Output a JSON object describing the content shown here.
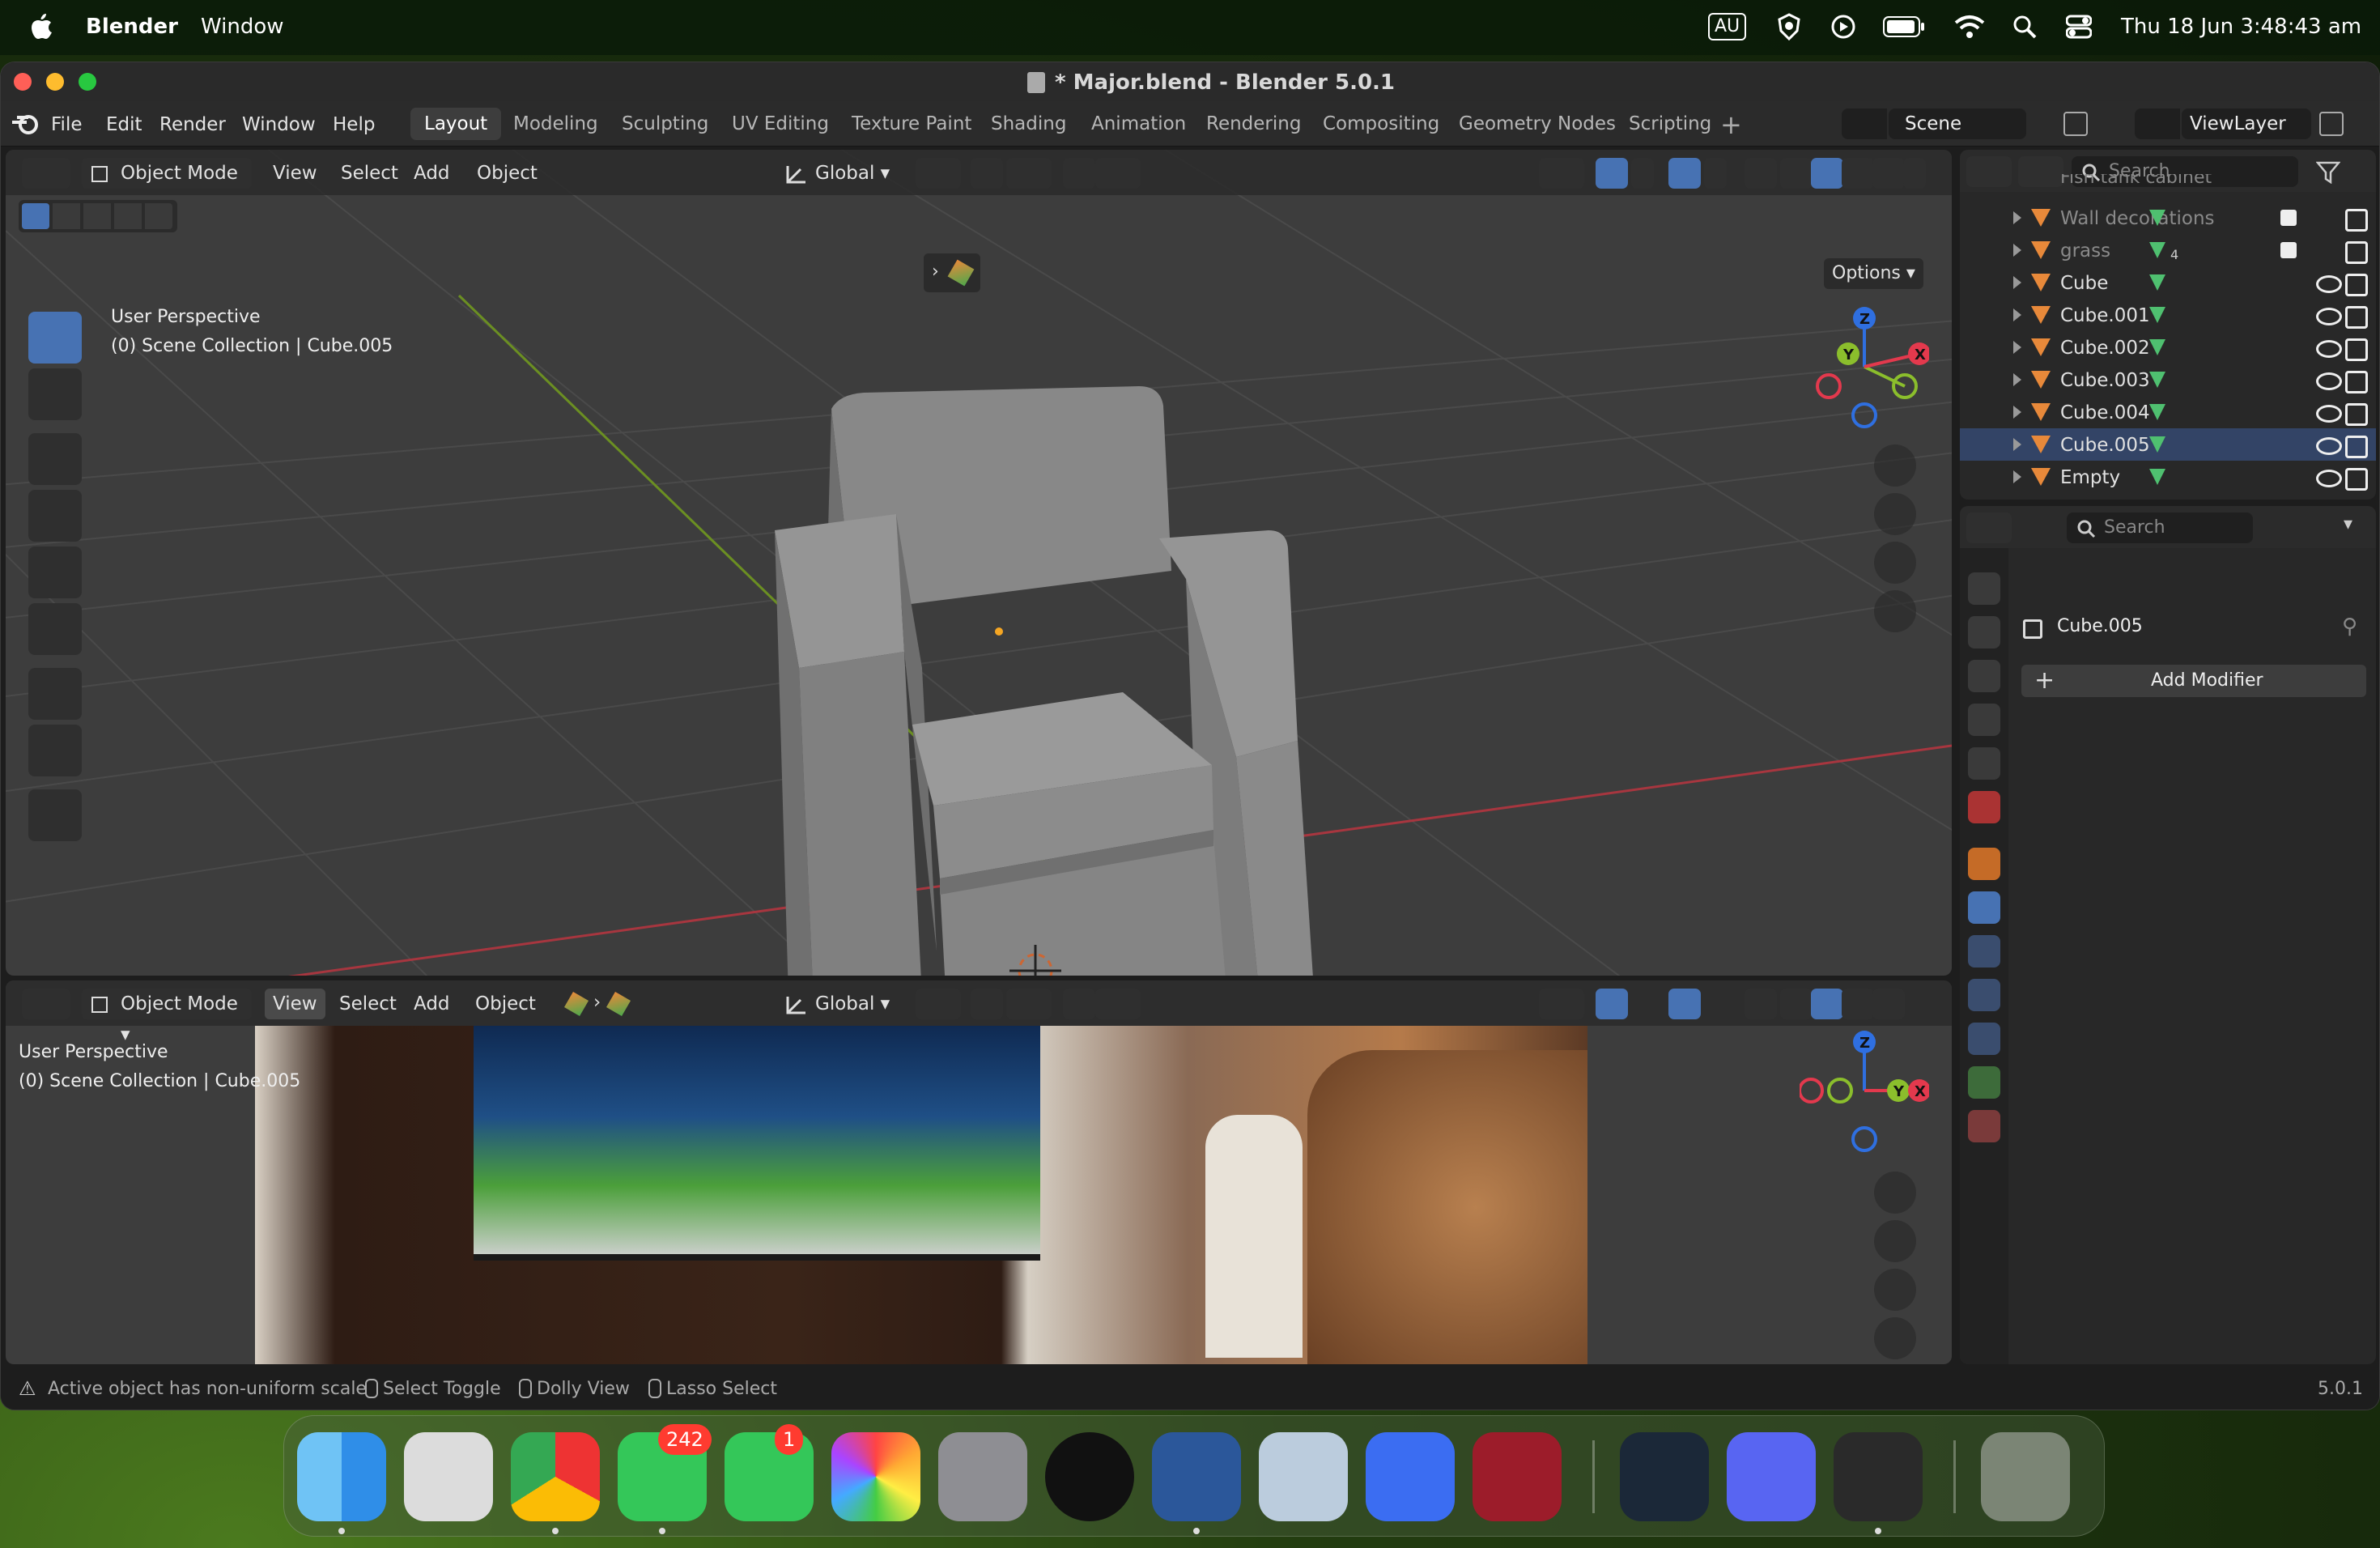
{
  "menubar": {
    "app": "Blender",
    "menu": "Window",
    "status": {
      "input_source": "AU",
      "datetime": "Thu 18 Jun  3:48:43 am"
    }
  },
  "window": {
    "title": "* Major.blend - Blender 5.0.1"
  },
  "topbar": {
    "menus": [
      "File",
      "Edit",
      "Render",
      "Window",
      "Help"
    ],
    "workspaces": [
      "Layout",
      "Modeling",
      "Sculpting",
      "UV Editing",
      "Texture Paint",
      "Shading",
      "Animation",
      "Rendering",
      "Compositing",
      "Geometry Nodes",
      "Scripting"
    ],
    "active_workspace": "Layout",
    "scene": "Scene",
    "view_layer": "ViewLayer"
  },
  "viewport_top": {
    "mode": "Object Mode",
    "menus": [
      "View",
      "Select",
      "Add",
      "Object"
    ],
    "transform": "Global",
    "options_label": "Options",
    "overlay_line1": "User Perspective",
    "overlay_line2": "(0) Scene Collection | Cube.005"
  },
  "viewport_bottom": {
    "mode": "Object Mode",
    "menus": [
      "View",
      "Select",
      "Add",
      "Object"
    ],
    "transform": "Global",
    "overlay_line1": "User Perspective",
    "overlay_line2": "(0) Scene Collection | Cube.005"
  },
  "gizmo": {
    "z": "Z",
    "y": "Y",
    "x": "X"
  },
  "outliner": {
    "search_placeholder": "Search",
    "partial_top": "Fish tank cabinet",
    "items": [
      {
        "name": "Wall decorations",
        "dim": true
      },
      {
        "name": "grass",
        "dim": true
      },
      {
        "name": "Cube",
        "dim": false
      },
      {
        "name": "Cube.001",
        "dim": false
      },
      {
        "name": "Cube.002",
        "dim": false
      },
      {
        "name": "Cube.003",
        "dim": false
      },
      {
        "name": "Cube.004",
        "dim": false
      },
      {
        "name": "Cube.005",
        "dim": false
      },
      {
        "name": "Empty",
        "dim": false
      }
    ],
    "grass_count": "4"
  },
  "properties": {
    "search_placeholder": "Search",
    "object_name": "Cube.005",
    "add_modifier": "Add Modifier"
  },
  "statusbar": {
    "warning": "Active object has non-uniform scale",
    "hints": [
      "Select Toggle",
      "Dolly View",
      "Lasso Select"
    ],
    "version": "5.0.1"
  },
  "dock": {
    "apps": [
      "Finder",
      "Launchpad",
      "Chrome",
      "Messages",
      "FaceTime",
      "Photos",
      "System Settings",
      "Spotify",
      "Word",
      "Preview",
      "Roblox",
      "Wesfarmers",
      "Steam",
      "Discord",
      "Blender",
      "Trash"
    ],
    "messages_badge": "242",
    "facetime_badge": "1"
  },
  "colors": {
    "accent": "#4772b3",
    "mesh_orange": "#e8893a",
    "viewport_bg": "#3d3d3d",
    "x_axis": "#e3394d",
    "y_axis": "#8bbe2c",
    "z_axis": "#2f6fe0"
  }
}
